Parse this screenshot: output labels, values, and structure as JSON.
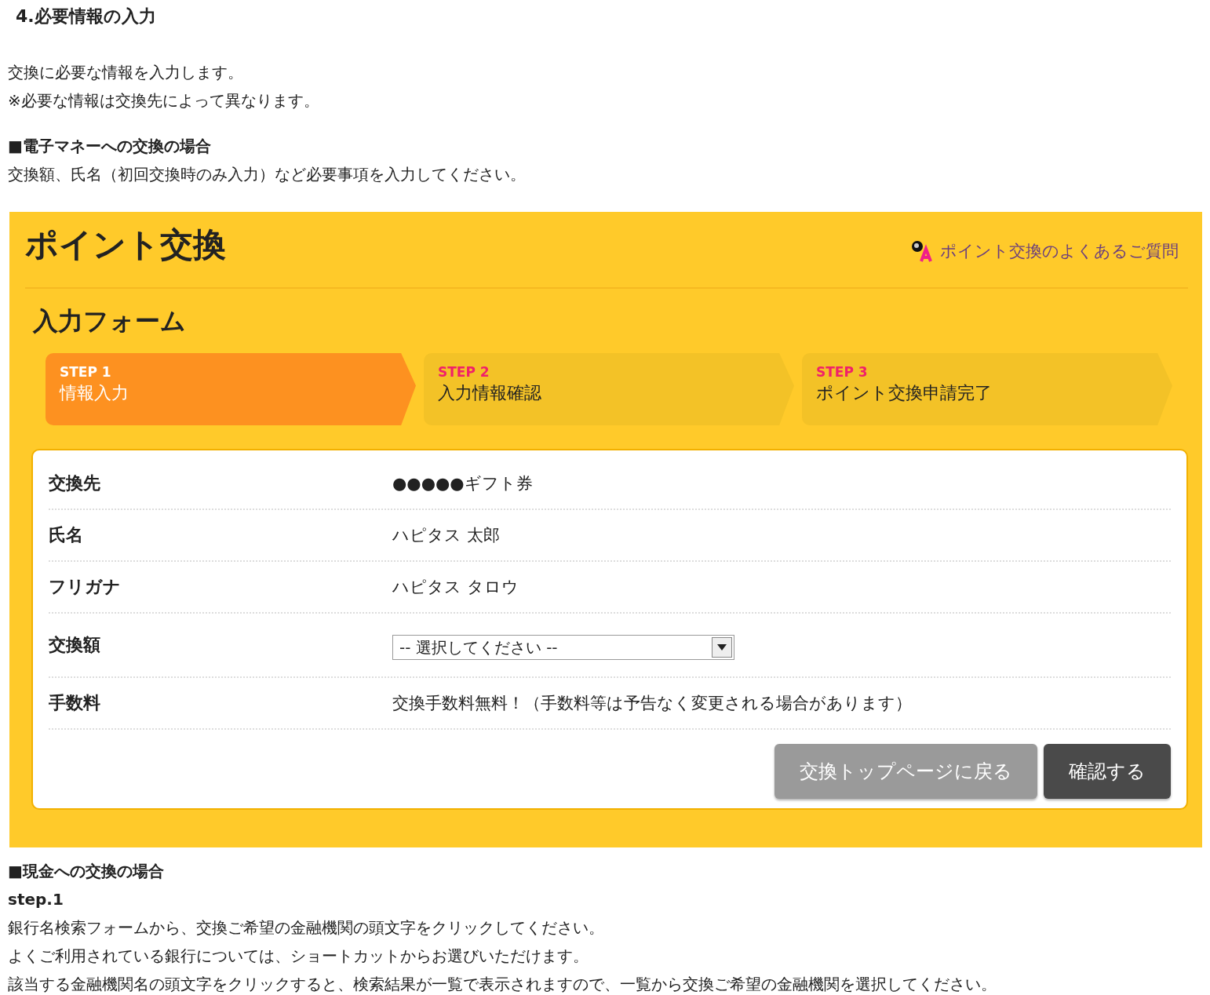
{
  "heading": "4.必要情報の入力",
  "intro": [
    "交換に必要な情報を入力します。",
    "※必要な情報は交換先によって異なります。"
  ],
  "section_emoney": {
    "title": "■電子マネーへの交換の場合",
    "text": "交換額、氏名（初回交換時のみ入力）など必要事項を入力してください。"
  },
  "panel": {
    "title": "ポイント交換",
    "faq_link": "ポイント交換のよくあるご質問",
    "form_title": "入力フォーム",
    "steps": [
      {
        "step": "STEP 1",
        "label": "情報入力",
        "selected": true
      },
      {
        "step": "STEP 2",
        "label": "入力情報確認",
        "selected": false
      },
      {
        "step": "STEP 3",
        "label": "ポイント交換申請完了",
        "selected": false
      }
    ],
    "rows": [
      {
        "kind": "text",
        "label": "交換先",
        "value": "●●●●●ギフト券"
      },
      {
        "kind": "text",
        "label": "氏名",
        "value": "ハピタス 太郎"
      },
      {
        "kind": "text",
        "label": "フリガナ",
        "value": "ハピタス タロウ"
      },
      {
        "kind": "select",
        "label": "交換額",
        "value": "-- 選択してください --"
      },
      {
        "kind": "text",
        "label": "手数料",
        "value": "交換手数料無料！（手数料等は予告なく変更される場合があります）"
      }
    ],
    "buttons": [
      {
        "kind": "secondary",
        "label": "交換トップページに戻る"
      },
      {
        "kind": "primary",
        "label": "確認する"
      }
    ]
  },
  "section_cash": {
    "title": "■現金への交換の場合",
    "subtitle": "step.1",
    "lines": [
      "銀行名検索フォームから、交換ご希望の金融機関の頭文字をクリックしてください。",
      "よくご利用されている銀行については、ショートカットからお選びいただけます。",
      "該当する金融機関名の頭文字をクリックすると、検索結果が一覧で表示されますので、一覧から交換ご希望の金融機関を選択してください。"
    ]
  }
}
